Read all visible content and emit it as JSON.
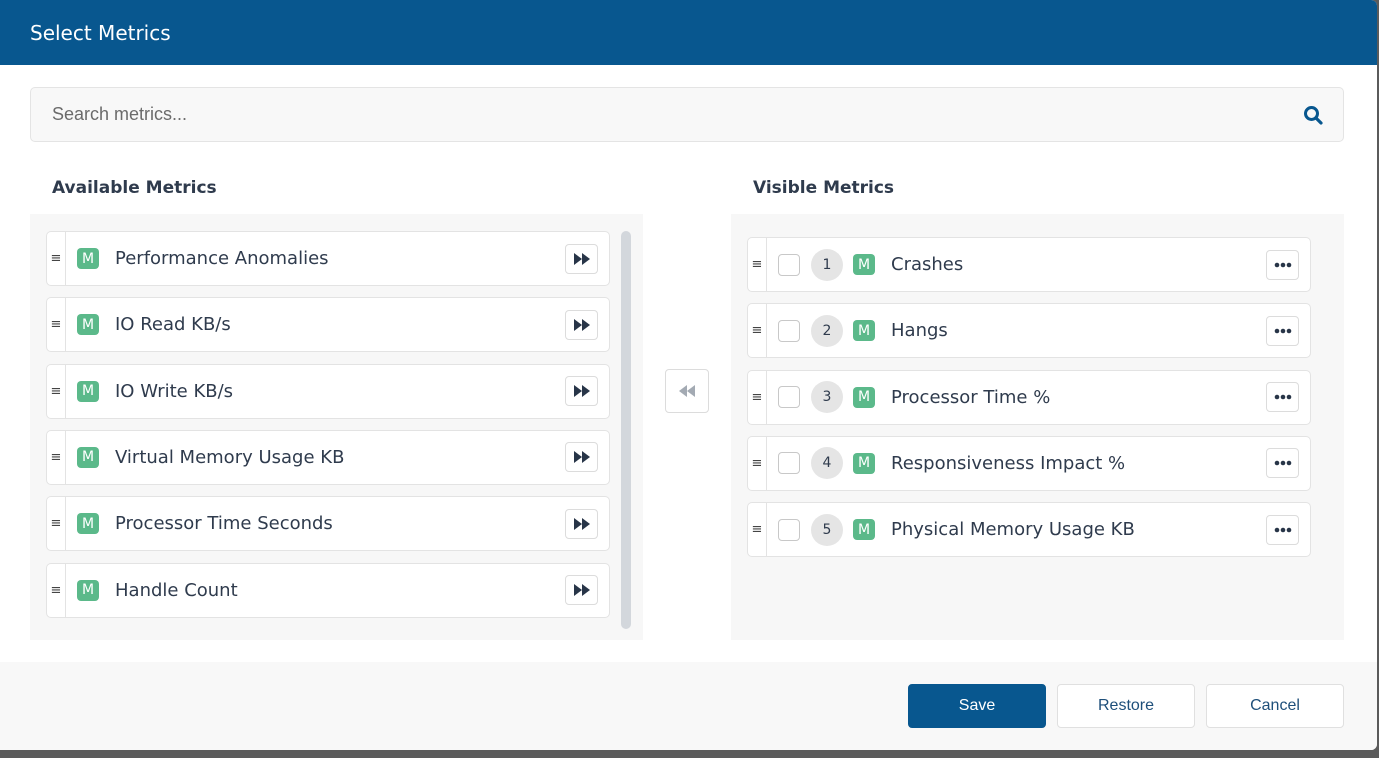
{
  "dialog": {
    "title": "Select Metrics"
  },
  "search": {
    "placeholder": "Search metrics...",
    "value": "",
    "icon": "search-icon"
  },
  "available": {
    "title": "Available Metrics",
    "badge": "M",
    "items": [
      {
        "label": "Performance Anomalies"
      },
      {
        "label": "IO Read KB/s"
      },
      {
        "label": "IO Write KB/s"
      },
      {
        "label": "Virtual Memory Usage KB"
      },
      {
        "label": "Processor Time Seconds"
      },
      {
        "label": "Handle Count"
      }
    ],
    "add_icon": "fast-forward-icon"
  },
  "visible": {
    "title": "Visible Metrics",
    "badge": "M",
    "items": [
      {
        "order": "1",
        "label": "Crashes",
        "checked": false
      },
      {
        "order": "2",
        "label": "Hangs",
        "checked": false
      },
      {
        "order": "3",
        "label": "Processor Time %",
        "checked": false
      },
      {
        "order": "4",
        "label": "Responsiveness Impact %",
        "checked": false
      },
      {
        "order": "5",
        "label": "Physical Memory Usage KB",
        "checked": false
      }
    ],
    "more_icon": "ellipsis-icon"
  },
  "remove_icon": "rewind-icon",
  "footer": {
    "save_label": "Save",
    "restore_label": "Restore",
    "cancel_label": "Cancel"
  },
  "colors": {
    "primary": "#08578f",
    "badge": "#5bb98a"
  }
}
